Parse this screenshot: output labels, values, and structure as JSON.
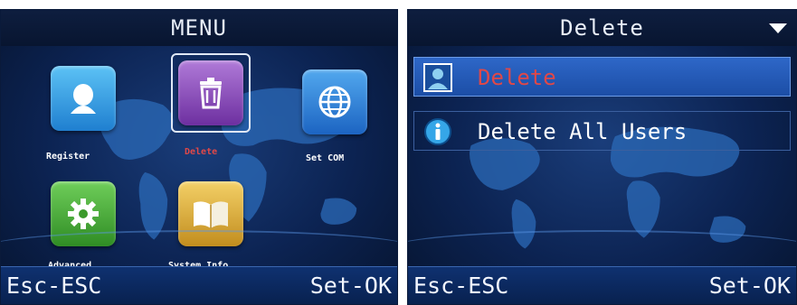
{
  "left_screen": {
    "title": "MENU",
    "icons": [
      {
        "label": "Register",
        "icon": "user-icon",
        "color": "#3aa0e6"
      },
      {
        "label": "Delete",
        "icon": "trash-icon",
        "color": "#8e4fb8",
        "selected": true,
        "label_color": "#e04848"
      },
      {
        "label": "Set COM",
        "icon": "globe-icon",
        "color": "#2f86d8"
      },
      {
        "label": "Advanced",
        "icon": "gear-icon",
        "color": "#4cae3c"
      },
      {
        "label": "System Info",
        "icon": "book-icon",
        "color": "#e0b23c"
      }
    ],
    "softkey_left": "Esc-ESC",
    "softkey_right": "Set-OK"
  },
  "right_screen": {
    "title": "Delete",
    "dropdown_icon": "triangle-down-icon",
    "items": [
      {
        "label": "Delete",
        "icon": "user-photo-icon",
        "active": true,
        "text_color": "#e04848"
      },
      {
        "label": "Delete All Users",
        "icon": "info-icon",
        "active": false,
        "text_color": "#ffffff"
      }
    ],
    "softkey_left": "Esc-ESC",
    "softkey_right": "Set-OK"
  },
  "colors": {
    "screen_bg": "#0c2352",
    "highlight": "#2e67c8",
    "selected_text": "#e04848"
  }
}
